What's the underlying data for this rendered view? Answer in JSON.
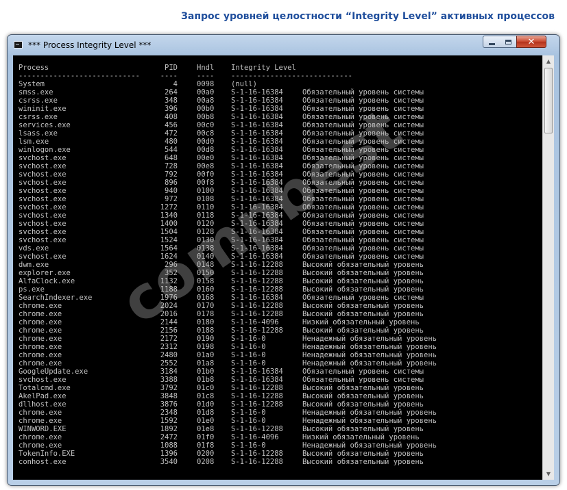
{
  "page": {
    "caption": "Запрос уровней целостности “Integrity Level” активных процессов",
    "watermark": "compbest"
  },
  "window": {
    "title": "*** Process Integrity Level ***",
    "controls": {
      "minimize_icon": "minimize-icon",
      "maximize_icon": "maximize-icon",
      "close_icon": "close-icon",
      "close_glyph": "✕"
    }
  },
  "colors": {
    "console_bg": "#000000",
    "console_text": "#c0c0c0",
    "caption": "#1f4e9c"
  },
  "console": {
    "headers": {
      "process": "Process",
      "pid": "PID",
      "hndl": "Hndl",
      "integrity": "Integrity Level"
    },
    "separators": {
      "process": "----------------------------",
      "pid": "----",
      "hndl": "----",
      "integrity": "----------------------------"
    },
    "rows": [
      {
        "process": "System",
        "pid": "4",
        "hndl": "0098",
        "sid": "(null)",
        "desc": ""
      },
      {
        "process": "smss.exe",
        "pid": "264",
        "hndl": "00a0",
        "sid": "S-1-16-16384",
        "desc": "Обязательный уровень системы"
      },
      {
        "process": "csrss.exe",
        "pid": "348",
        "hndl": "00a8",
        "sid": "S-1-16-16384",
        "desc": "Обязательный уровень системы"
      },
      {
        "process": "wininit.exe",
        "pid": "396",
        "hndl": "00b0",
        "sid": "S-1-16-16384",
        "desc": "Обязательный уровень системы"
      },
      {
        "process": "csrss.exe",
        "pid": "408",
        "hndl": "00b8",
        "sid": "S-1-16-16384",
        "desc": "Обязательный уровень системы"
      },
      {
        "process": "services.exe",
        "pid": "456",
        "hndl": "00c0",
        "sid": "S-1-16-16384",
        "desc": "Обязательный уровень системы"
      },
      {
        "process": "lsass.exe",
        "pid": "472",
        "hndl": "00c8",
        "sid": "S-1-16-16384",
        "desc": "Обязательный уровень системы"
      },
      {
        "process": "lsm.exe",
        "pid": "480",
        "hndl": "00d0",
        "sid": "S-1-16-16384",
        "desc": "Обязательный уровень системы"
      },
      {
        "process": "winlogon.exe",
        "pid": "544",
        "hndl": "00d8",
        "sid": "S-1-16-16384",
        "desc": "Обязательный уровень системы"
      },
      {
        "process": "svchost.exe",
        "pid": "648",
        "hndl": "00e0",
        "sid": "S-1-16-16384",
        "desc": "Обязательный уровень системы"
      },
      {
        "process": "svchost.exe",
        "pid": "728",
        "hndl": "00e8",
        "sid": "S-1-16-16384",
        "desc": "Обязательный уровень системы"
      },
      {
        "process": "svchost.exe",
        "pid": "792",
        "hndl": "00f0",
        "sid": "S-1-16-16384",
        "desc": "Обязательный уровень системы"
      },
      {
        "process": "svchost.exe",
        "pid": "896",
        "hndl": "00f8",
        "sid": "S-1-16-16384",
        "desc": "Обязательный уровень системы"
      },
      {
        "process": "svchost.exe",
        "pid": "940",
        "hndl": "0100",
        "sid": "S-1-16-16384",
        "desc": "Обязательный уровень системы"
      },
      {
        "process": "svchost.exe",
        "pid": "972",
        "hndl": "0108",
        "sid": "S-1-16-16384",
        "desc": "Обязательный уровень системы"
      },
      {
        "process": "svchost.exe",
        "pid": "1272",
        "hndl": "0110",
        "sid": "S-1-16-16384",
        "desc": "Обязательный уровень системы"
      },
      {
        "process": "svchost.exe",
        "pid": "1340",
        "hndl": "0118",
        "sid": "S-1-16-16384",
        "desc": "Обязательный уровень системы"
      },
      {
        "process": "svchost.exe",
        "pid": "1400",
        "hndl": "0120",
        "sid": "S-1-16-16384",
        "desc": "Обязательный уровень системы"
      },
      {
        "process": "svchost.exe",
        "pid": "1504",
        "hndl": "0128",
        "sid": "S-1-16-16384",
        "desc": "Обязательный уровень системы"
      },
      {
        "process": "svchost.exe",
        "pid": "1524",
        "hndl": "0130",
        "sid": "S-1-16-16384",
        "desc": "Обязательный уровень системы"
      },
      {
        "process": "vds.exe",
        "pid": "1564",
        "hndl": "0138",
        "sid": "S-1-16-16384",
        "desc": "Обязательный уровень системы"
      },
      {
        "process": "svchost.exe",
        "pid": "1624",
        "hndl": "0140",
        "sid": "S-1-16-16384",
        "desc": "Обязательный уровень системы"
      },
      {
        "process": "dwm.exe",
        "pid": "296",
        "hndl": "0148",
        "sid": "S-1-16-12288",
        "desc": "Высокий обязательный уровень"
      },
      {
        "process": "explorer.exe",
        "pid": "352",
        "hndl": "0150",
        "sid": "S-1-16-12288",
        "desc": "Высокий обязательный уровень"
      },
      {
        "process": "AlfaClock.exe",
        "pid": "1132",
        "hndl": "0158",
        "sid": "S-1-16-12288",
        "desc": "Высокий обязательный уровень"
      },
      {
        "process": "ps.exe",
        "pid": "1188",
        "hndl": "0160",
        "sid": "S-1-16-12288",
        "desc": "Высокий обязательный уровень"
      },
      {
        "process": "SearchIndexer.exe",
        "pid": "1976",
        "hndl": "0168",
        "sid": "S-1-16-16384",
        "desc": "Обязательный уровень системы"
      },
      {
        "process": "chrome.exe",
        "pid": "2024",
        "hndl": "0170",
        "sid": "S-1-16-12288",
        "desc": "Высокий обязательный уровень"
      },
      {
        "process": "chrome.exe",
        "pid": "2016",
        "hndl": "0178",
        "sid": "S-1-16-12288",
        "desc": "Высокий обязательный уровень"
      },
      {
        "process": "chrome.exe",
        "pid": "2144",
        "hndl": "0180",
        "sid": "S-1-16-4096",
        "desc": "Низкий обязательный уровень"
      },
      {
        "process": "chrome.exe",
        "pid": "2156",
        "hndl": "0188",
        "sid": "S-1-16-12288",
        "desc": "Высокий обязательный уровень"
      },
      {
        "process": "chrome.exe",
        "pid": "2172",
        "hndl": "0190",
        "sid": "S-1-16-0",
        "desc": "Ненадежный обязательный уровень"
      },
      {
        "process": "chrome.exe",
        "pid": "2312",
        "hndl": "0198",
        "sid": "S-1-16-0",
        "desc": "Ненадежный обязательный уровень"
      },
      {
        "process": "chrome.exe",
        "pid": "2480",
        "hndl": "01a0",
        "sid": "S-1-16-0",
        "desc": "Ненадежный обязательный уровень"
      },
      {
        "process": "chrome.exe",
        "pid": "2552",
        "hndl": "01a8",
        "sid": "S-1-16-0",
        "desc": "Ненадежный обязательный уровень"
      },
      {
        "process": "GoogleUpdate.exe",
        "pid": "3184",
        "hndl": "01b0",
        "sid": "S-1-16-16384",
        "desc": "Обязательный уровень системы"
      },
      {
        "process": "svchost.exe",
        "pid": "3388",
        "hndl": "01b8",
        "sid": "S-1-16-16384",
        "desc": "Обязательный уровень системы"
      },
      {
        "process": "Totalcmd.exe",
        "pid": "3792",
        "hndl": "01c0",
        "sid": "S-1-16-12288",
        "desc": "Высокий обязательный уровень"
      },
      {
        "process": "AkelPad.exe",
        "pid": "3848",
        "hndl": "01c8",
        "sid": "S-1-16-12288",
        "desc": "Высокий обязательный уровень"
      },
      {
        "process": "dllhost.exe",
        "pid": "3876",
        "hndl": "01d0",
        "sid": "S-1-16-12288",
        "desc": "Высокий обязательный уровень"
      },
      {
        "process": "chrome.exe",
        "pid": "2348",
        "hndl": "01d8",
        "sid": "S-1-16-0",
        "desc": "Ненадежный обязательный уровень"
      },
      {
        "process": "chrome.exe",
        "pid": "1592",
        "hndl": "01e0",
        "sid": "S-1-16-0",
        "desc": "Ненадежный обязательный уровень"
      },
      {
        "process": "WINWORD.EXE",
        "pid": "1892",
        "hndl": "01e8",
        "sid": "S-1-16-12288",
        "desc": "Высокий обязательный уровень"
      },
      {
        "process": "chrome.exe",
        "pid": "2472",
        "hndl": "01f0",
        "sid": "S-1-16-4096",
        "desc": "Низкий обязательный уровень"
      },
      {
        "process": "chrome.exe",
        "pid": "1088",
        "hndl": "01f8",
        "sid": "S-1-16-0",
        "desc": "Ненадежный обязательный уровень"
      },
      {
        "process": "TokenInfo.EXE",
        "pid": "1396",
        "hndl": "0200",
        "sid": "S-1-16-12288",
        "desc": "Высокий обязательный уровень"
      },
      {
        "process": "conhost.exe",
        "pid": "3540",
        "hndl": "0208",
        "sid": "S-1-16-12288",
        "desc": "Высокий обязательный уровень"
      }
    ]
  },
  "scrollbar": {
    "up_glyph": "▲",
    "down_glyph": "▼",
    "up_icon": "scroll-up-arrow-icon",
    "down_icon": "scroll-down-arrow-icon"
  }
}
